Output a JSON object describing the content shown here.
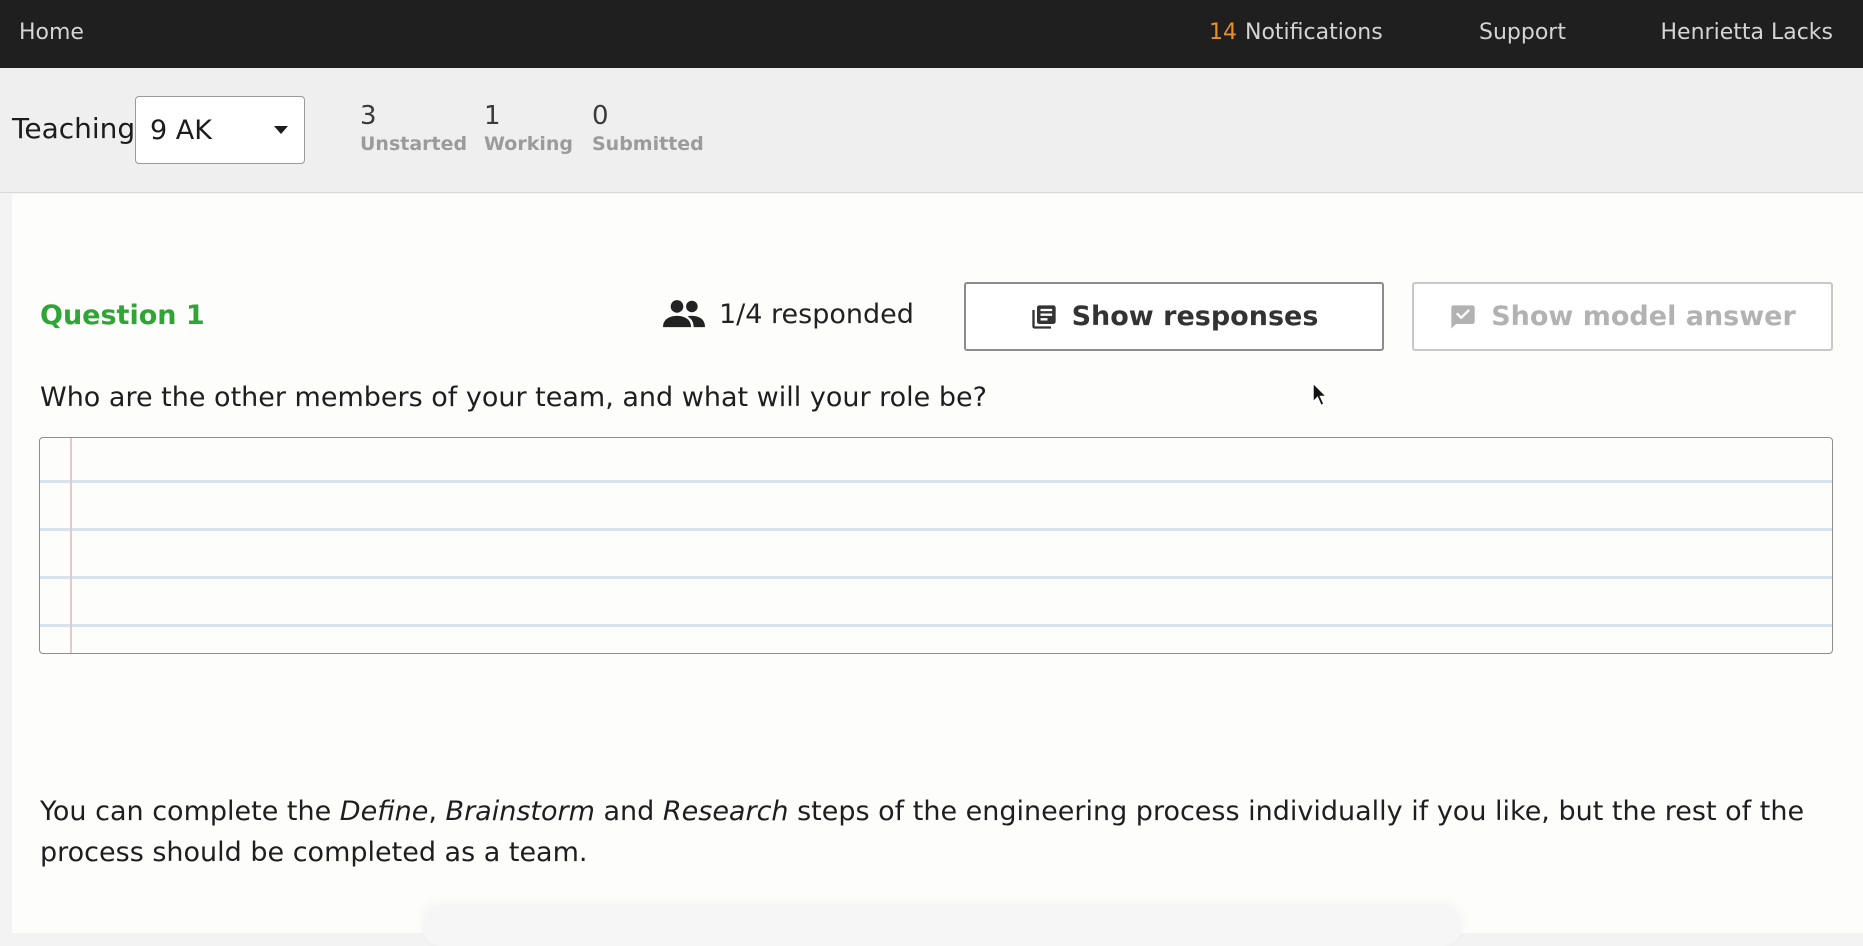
{
  "nav": {
    "home": "Home",
    "notifications_count": "14",
    "notifications_label": "Notifications",
    "support": "Support",
    "user_name": "Henrietta Lacks"
  },
  "classbar": {
    "teaching_label": "Teaching",
    "selected_class": "9 AK",
    "stats": {
      "unstarted": {
        "count": "3",
        "label": "Unstarted"
      },
      "working": {
        "count": "1",
        "label": "Working"
      },
      "submitted": {
        "count": "0",
        "label": "Submitted"
      }
    }
  },
  "question": {
    "title": "Question 1",
    "responded": "1/4 responded",
    "show_responses_label": "Show responses",
    "show_model_answer_label": "Show model answer",
    "text": "Who are the other members of your team, and what will your role be?",
    "answer_value": ""
  },
  "info": {
    "part1": "You can complete the ",
    "define": "Define",
    "sep1": ", ",
    "brainstorm": "Brainstorm",
    "sep2": " and ",
    "research": "Research",
    "part2": " steps of the engineering process individually if you like, but the rest of the process should be completed as a team."
  },
  "colors": {
    "accent_green": "#2ea534",
    "notification_orange": "#e8902e",
    "nav_background": "#1f1f1f"
  },
  "icons": {
    "responded": "people-icon",
    "show_responses": "library-books-icon",
    "show_model_answer": "checked-comment-icon"
  }
}
